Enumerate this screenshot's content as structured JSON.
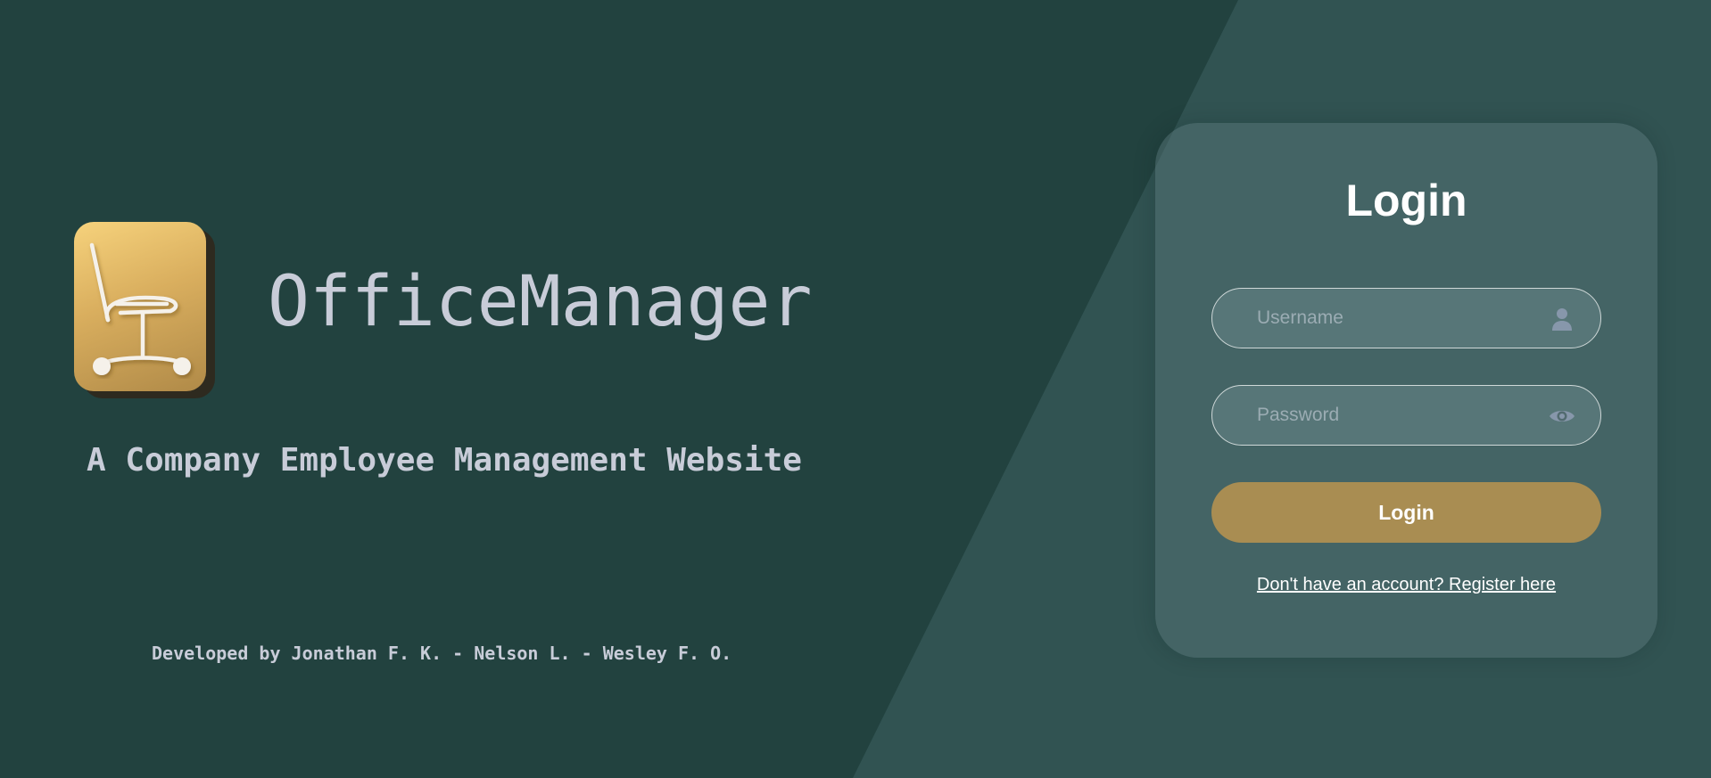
{
  "brand": {
    "title": "OfficeManager",
    "subtitle": "A Company Employee Management Website",
    "credits": "Developed by Jonathan F. K. - Nelson L. - Wesley F. O.",
    "logo_icon": "office-chair-icon"
  },
  "login": {
    "title": "Login",
    "username": {
      "value": "",
      "placeholder": "Username",
      "icon": "user-icon"
    },
    "password": {
      "value": "",
      "placeholder": "Password",
      "icon": "eye-icon"
    },
    "submit_label": "Login",
    "register_link": "Don't have an account? Register here"
  },
  "colors": {
    "background_dark": "#22423f",
    "background_light": "#315352",
    "accent": "#a98d52",
    "logo_gold": "#f6d27c",
    "text_light": "#c8ccd8"
  }
}
